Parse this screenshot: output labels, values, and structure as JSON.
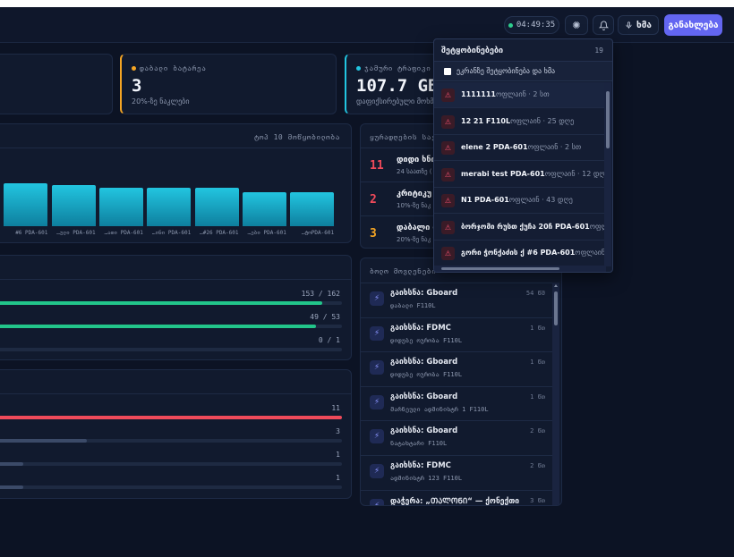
{
  "header": {
    "clock": "04:49:35",
    "voice_label": "ხმა",
    "update_label": "განახლება"
  },
  "stats": [
    {
      "label": "დაბალი ბატარეა",
      "value": "3",
      "sub": "20%-ზე ნაკლები",
      "color": "#f5a524"
    },
    {
      "label": "ჯამური ტრაფიკი",
      "value": "107.7 GB",
      "sub": "დაფიქსირებული მოხმ",
      "color": "#22c5e0"
    }
  ],
  "chart_panel": {
    "top_label": "ტოპ 10 მოწყობილობა"
  },
  "chart_data": {
    "type": "bar",
    "categories": [
      "01",
      "#6 PDA-601",
      "…ული PDA-601",
      "…ათი PDA-601",
      "…ინი PDA-601",
      "…#26 PDA-601",
      "…ები PDA-601",
      "…ტოPDA-601"
    ],
    "values": [
      0.92,
      0.88,
      0.86,
      0.8,
      0.79,
      0.79,
      0.7,
      0.7
    ],
    "title": "",
    "xlabel": "",
    "ylabel": "",
    "ylim": [
      0,
      1
    ]
  },
  "progress1": [
    {
      "text": "153 / 162",
      "fraction": 0.944,
      "color": "#22c58a"
    },
    {
      "text": "49 / 53",
      "fraction": 0.925,
      "color": "#22c58a"
    },
    {
      "text": "0 / 1",
      "fraction": 0,
      "color": "#22c58a"
    }
  ],
  "progress2": [
    {
      "text": "11",
      "fraction": 1.0,
      "color": "#ef4a5a"
    },
    {
      "text": "3",
      "fraction": 0.27,
      "color": "#3b4a68"
    },
    {
      "text": "1",
      "fraction": 0.09,
      "color": "#3b4a68"
    },
    {
      "text": "1",
      "fraction": 0.09,
      "color": "#3b4a68"
    }
  ],
  "alerts": {
    "title": "ყურადღების საჭ",
    "rows": [
      {
        "num": "11",
        "title": "დიდი ხნი",
        "sub": "24 საათზე (",
        "color": "#ef4a5a"
      },
      {
        "num": "2",
        "title": "კრიტიკუ",
        "sub": "10%-ზე ნაკ",
        "color": "#ef4a5a"
      },
      {
        "num": "3",
        "title": "დაბალი ბ",
        "sub": "20%-ზე ნაკ",
        "color": "#f5a524"
      }
    ]
  },
  "activity": {
    "title": "ბოლო მოვლენები",
    "items": [
      {
        "title": "გაიხსნა: Gboard",
        "sub": "დაბალი F110L",
        "time": "54 წმ"
      },
      {
        "title": "გაიხსნა: FDMC",
        "sub": "დიდუბე ოჯრობა F110L",
        "time": "1 წთ"
      },
      {
        "title": "გაიხსნა: Gboard",
        "sub": "დიდუბე ოჯრობა F110L",
        "time": "1 წთ"
      },
      {
        "title": "გაიხსნა: Gboard",
        "sub": "მარნეული ადმინისტრ 1 F110L",
        "time": "1 წთ"
      },
      {
        "title": "გაიხსნა: Gboard",
        "sub": "ნატახტარი F110L",
        "time": "2 წთ"
      },
      {
        "title": "გაიხსნა: FDMC",
        "sub": "ადმინისტრ 123 F110L",
        "time": "2 წთ"
      },
      {
        "title": "დაჭერა: „ᲗᲐᲚᲝᲜᲘ“ — ქონექთი",
        "sub": "",
        "time": "3 წთ"
      }
    ]
  },
  "notifications": {
    "title": "შეტყობინებები",
    "count": "19",
    "checkbox_label": "ეკრანზე შეტყობინება და ხმა",
    "items": [
      {
        "name": "1111111",
        "meta": "ოფლაინ · 2 სთ"
      },
      {
        "name": "12 21 F110L",
        "meta": "ოფლაინ · 25 დღე"
      },
      {
        "name": "elene 2 PDA-601",
        "meta": "ოფლაინ · 2 სთ"
      },
      {
        "name": "merabi test PDA-601",
        "meta": "ოფლაინ · 12 დღე"
      },
      {
        "name": "N1 PDA-601",
        "meta": "ოფლაინ · 43 დღე"
      },
      {
        "name": "ბორჯომი რუსთ ქუჩა 20ჩ PDA-601",
        "meta": "ოფლაი · 2 სთ"
      },
      {
        "name": "გორი ჭონქაძის ქ #6 PDA-601",
        "meta": "ოფლაინ · 38 დღე"
      }
    ]
  }
}
